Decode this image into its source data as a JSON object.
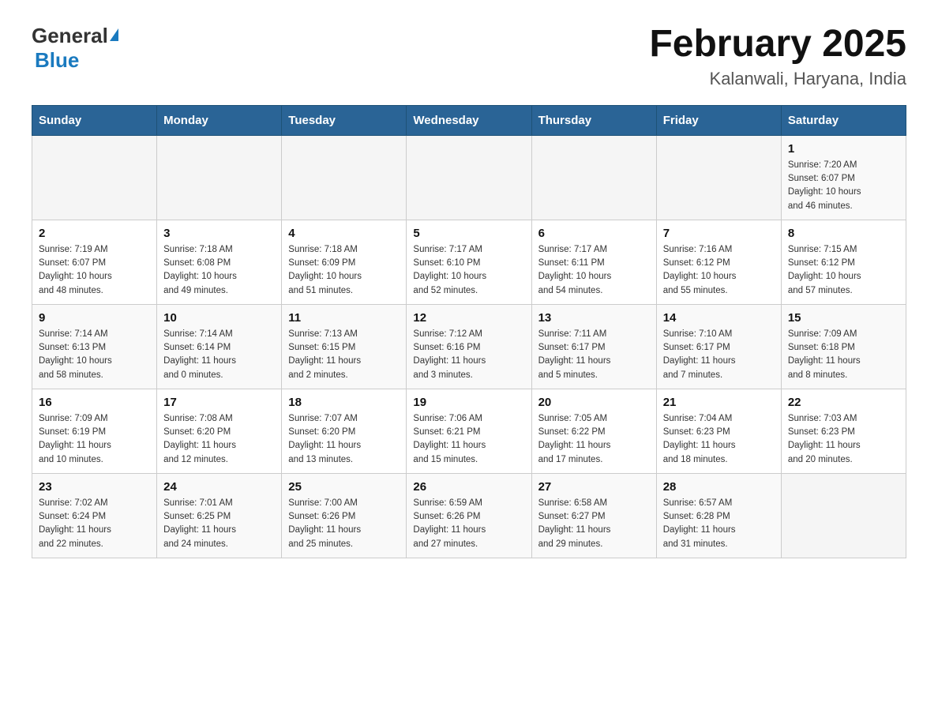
{
  "header": {
    "logo_general": "General",
    "logo_blue": "Blue",
    "title": "February 2025",
    "subtitle": "Kalanwali, Haryana, India"
  },
  "days_of_week": [
    "Sunday",
    "Monday",
    "Tuesday",
    "Wednesday",
    "Thursday",
    "Friday",
    "Saturday"
  ],
  "weeks": [
    [
      {
        "day": "",
        "info": ""
      },
      {
        "day": "",
        "info": ""
      },
      {
        "day": "",
        "info": ""
      },
      {
        "day": "",
        "info": ""
      },
      {
        "day": "",
        "info": ""
      },
      {
        "day": "",
        "info": ""
      },
      {
        "day": "1",
        "info": "Sunrise: 7:20 AM\nSunset: 6:07 PM\nDaylight: 10 hours\nand 46 minutes."
      }
    ],
    [
      {
        "day": "2",
        "info": "Sunrise: 7:19 AM\nSunset: 6:07 PM\nDaylight: 10 hours\nand 48 minutes."
      },
      {
        "day": "3",
        "info": "Sunrise: 7:18 AM\nSunset: 6:08 PM\nDaylight: 10 hours\nand 49 minutes."
      },
      {
        "day": "4",
        "info": "Sunrise: 7:18 AM\nSunset: 6:09 PM\nDaylight: 10 hours\nand 51 minutes."
      },
      {
        "day": "5",
        "info": "Sunrise: 7:17 AM\nSunset: 6:10 PM\nDaylight: 10 hours\nand 52 minutes."
      },
      {
        "day": "6",
        "info": "Sunrise: 7:17 AM\nSunset: 6:11 PM\nDaylight: 10 hours\nand 54 minutes."
      },
      {
        "day": "7",
        "info": "Sunrise: 7:16 AM\nSunset: 6:12 PM\nDaylight: 10 hours\nand 55 minutes."
      },
      {
        "day": "8",
        "info": "Sunrise: 7:15 AM\nSunset: 6:12 PM\nDaylight: 10 hours\nand 57 minutes."
      }
    ],
    [
      {
        "day": "9",
        "info": "Sunrise: 7:14 AM\nSunset: 6:13 PM\nDaylight: 10 hours\nand 58 minutes."
      },
      {
        "day": "10",
        "info": "Sunrise: 7:14 AM\nSunset: 6:14 PM\nDaylight: 11 hours\nand 0 minutes."
      },
      {
        "day": "11",
        "info": "Sunrise: 7:13 AM\nSunset: 6:15 PM\nDaylight: 11 hours\nand 2 minutes."
      },
      {
        "day": "12",
        "info": "Sunrise: 7:12 AM\nSunset: 6:16 PM\nDaylight: 11 hours\nand 3 minutes."
      },
      {
        "day": "13",
        "info": "Sunrise: 7:11 AM\nSunset: 6:17 PM\nDaylight: 11 hours\nand 5 minutes."
      },
      {
        "day": "14",
        "info": "Sunrise: 7:10 AM\nSunset: 6:17 PM\nDaylight: 11 hours\nand 7 minutes."
      },
      {
        "day": "15",
        "info": "Sunrise: 7:09 AM\nSunset: 6:18 PM\nDaylight: 11 hours\nand 8 minutes."
      }
    ],
    [
      {
        "day": "16",
        "info": "Sunrise: 7:09 AM\nSunset: 6:19 PM\nDaylight: 11 hours\nand 10 minutes."
      },
      {
        "day": "17",
        "info": "Sunrise: 7:08 AM\nSunset: 6:20 PM\nDaylight: 11 hours\nand 12 minutes."
      },
      {
        "day": "18",
        "info": "Sunrise: 7:07 AM\nSunset: 6:20 PM\nDaylight: 11 hours\nand 13 minutes."
      },
      {
        "day": "19",
        "info": "Sunrise: 7:06 AM\nSunset: 6:21 PM\nDaylight: 11 hours\nand 15 minutes."
      },
      {
        "day": "20",
        "info": "Sunrise: 7:05 AM\nSunset: 6:22 PM\nDaylight: 11 hours\nand 17 minutes."
      },
      {
        "day": "21",
        "info": "Sunrise: 7:04 AM\nSunset: 6:23 PM\nDaylight: 11 hours\nand 18 minutes."
      },
      {
        "day": "22",
        "info": "Sunrise: 7:03 AM\nSunset: 6:23 PM\nDaylight: 11 hours\nand 20 minutes."
      }
    ],
    [
      {
        "day": "23",
        "info": "Sunrise: 7:02 AM\nSunset: 6:24 PM\nDaylight: 11 hours\nand 22 minutes."
      },
      {
        "day": "24",
        "info": "Sunrise: 7:01 AM\nSunset: 6:25 PM\nDaylight: 11 hours\nand 24 minutes."
      },
      {
        "day": "25",
        "info": "Sunrise: 7:00 AM\nSunset: 6:26 PM\nDaylight: 11 hours\nand 25 minutes."
      },
      {
        "day": "26",
        "info": "Sunrise: 6:59 AM\nSunset: 6:26 PM\nDaylight: 11 hours\nand 27 minutes."
      },
      {
        "day": "27",
        "info": "Sunrise: 6:58 AM\nSunset: 6:27 PM\nDaylight: 11 hours\nand 29 minutes."
      },
      {
        "day": "28",
        "info": "Sunrise: 6:57 AM\nSunset: 6:28 PM\nDaylight: 11 hours\nand 31 minutes."
      },
      {
        "day": "",
        "info": ""
      }
    ]
  ]
}
